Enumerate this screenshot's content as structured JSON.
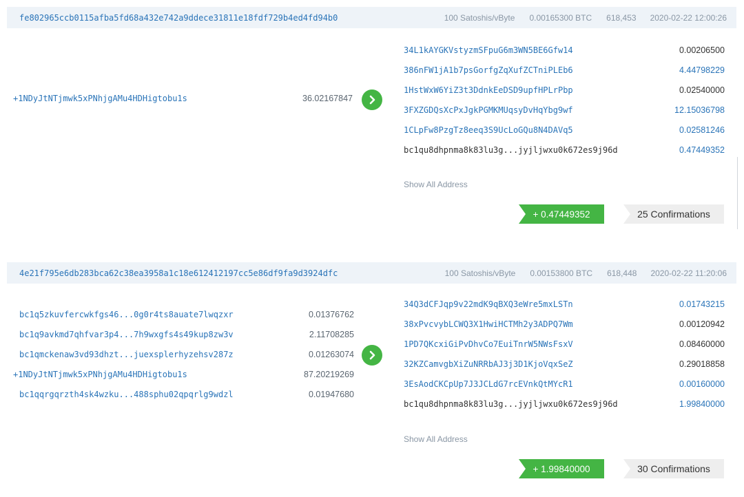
{
  "transactions": [
    {
      "hash": "fe802965ccb0115afba5fd68a432e742a9ddece31811e18fdf729b4ed4fd94b0",
      "fee_rate": "100 Satoshis/vByte",
      "fee": "0.00165300 BTC",
      "block": "618,453",
      "time": "2020-02-22 12:00:26",
      "inputs": [
        {
          "address": "+1NDyJtNTjmwk5xPNhjgAMu4HDHigtobu1s",
          "amount": "36.02167847"
        }
      ],
      "outputs": [
        {
          "address": "34L1kAYGKVstyzmSFpuG6m3WN5BE6Gfw14",
          "amount": "0.00206500"
        },
        {
          "address": "386nFW1jA1b7psGorfgZqXufZCTniPLEb6",
          "amount": "4.44798229"
        },
        {
          "address": "1HstWxW6YiZ3t3DdnkEeDSD9upfHPLrPbp",
          "amount": "0.02540000"
        },
        {
          "address": "3FXZGDQsXcPxJgkPGMKMUqsyDvHqYbg9wf",
          "amount": "12.15036798"
        },
        {
          "address": "1CLpFw8PzgTz8eeq3S9UcLoGQu8N4DAVq5",
          "amount": "0.02581246"
        },
        {
          "address": "bc1qu8dhpnma8k83lu3g...jyjljwxu0k672es9j96d",
          "amount": "0.47449352"
        }
      ],
      "show_all": "Show All Address",
      "total": "+ 0.47449352",
      "confirmations": "25 Confirmations"
    },
    {
      "hash": "4e21f795e6db283bca62c38ea3958a1c18e612412197cc5e86df9fa9d3924dfc",
      "fee_rate": "100 Satoshis/vByte",
      "fee": "0.00153800 BTC",
      "block": "618,448",
      "time": "2020-02-22 11:20:06",
      "inputs": [
        {
          "address": "bc1q5zkuvfercwkfgs46...0g0r4ts8auate7lwqzxr",
          "amount": "0.01376762"
        },
        {
          "address": "bc1q9avkmd7qhfvar3p4...7h9wxgfs4s49kup8zw3v",
          "amount": "2.11708285"
        },
        {
          "address": "bc1qmckenaw3vd93dhzt...juexsplerhyzehsv287z",
          "amount": "0.01263074"
        },
        {
          "address": "+1NDyJtNTjmwk5xPNhjgAMu4HDHigtobu1s",
          "amount": "87.20219269"
        },
        {
          "address": "bc1qqrgqrzth4sk4wzku...488sphu02qpqrlg9wdzl",
          "amount": "0.01947680"
        }
      ],
      "outputs": [
        {
          "address": "34Q3dCFJqp9v22mdK9qBXQ3eWre5mxLSTn",
          "amount": "0.01743215"
        },
        {
          "address": "38xPvcvybLCWQ3X1HwiHCTMh2y3ADPQ7Wm",
          "amount": "0.00120942"
        },
        {
          "address": "1PD7QKcxiGiPvDhvCo7EuiTnrW5NWsFsxV",
          "amount": "0.08460000"
        },
        {
          "address": "32KZCamvgbXiZuNRRbAJ3j3D1KjoVqxSeZ",
          "amount": "0.29018858"
        },
        {
          "address": "3EsAodCKCpUp7J3JCLdG7rcEVnkQtMYcR1",
          "amount": "0.00160000"
        },
        {
          "address": "bc1qu8dhpnma8k83lu3g...jyjljwxu0k672es9j96d",
          "amount": "1.99840000"
        }
      ],
      "show_all": "Show All Address",
      "total": "+ 1.99840000",
      "confirmations": "30 Confirmations"
    }
  ],
  "icons": {
    "arrow": "chevron-right-icon"
  },
  "colors": {
    "accent_green": "#44b544",
    "link_blue": "#2a74b8",
    "header_bg": "#eef3f8"
  }
}
